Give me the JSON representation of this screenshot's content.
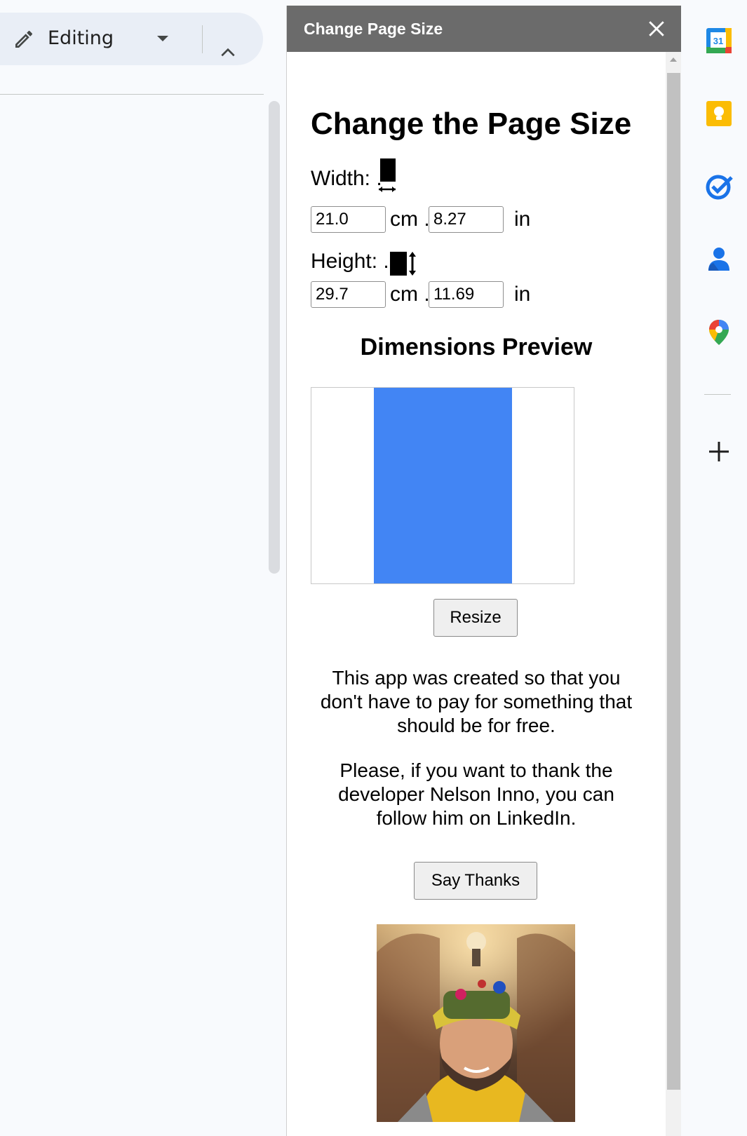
{
  "toolbar": {
    "mode_label": "Editing"
  },
  "dialog": {
    "title": "Change Page Size",
    "heading": "Change the Page Size",
    "width": {
      "label": "Width: .",
      "cm_value": "21.0",
      "cm_unit": "cm .",
      "in_value": "8.27",
      "in_unit": "in"
    },
    "height": {
      "label": "Height: .",
      "cm_value": "29.7",
      "cm_unit": "cm .",
      "in_value": "11.69",
      "in_unit": "in"
    },
    "preview_heading": "Dimensions Preview",
    "preview_page_color": "#4285f4",
    "resize_label": "Resize",
    "paragraph_1": "This app was created so that you don't have to pay for something that should be for free.",
    "paragraph_2": "Please, if you want to thank the developer Nelson Inno, you can follow him on LinkedIn.",
    "thanks_label": "Say Thanks"
  },
  "side_panel": {
    "icons": [
      "calendar-icon",
      "keep-icon",
      "tasks-icon",
      "contacts-icon",
      "maps-icon",
      "add-icon"
    ],
    "calendar_day": "31"
  },
  "colors": {
    "titlebar": "#6b6b6b",
    "accent_blue": "#4285f4",
    "keep_yellow": "#fbbc04"
  }
}
